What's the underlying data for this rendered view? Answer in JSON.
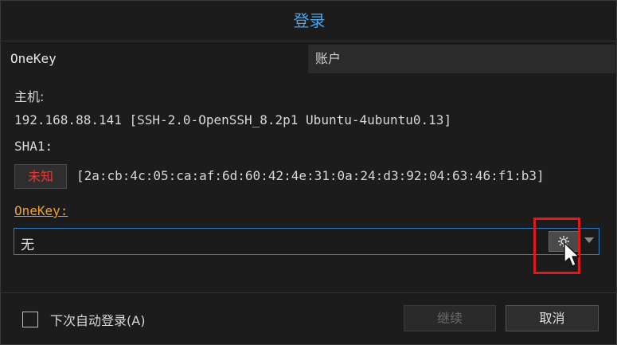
{
  "dialog": {
    "title": "登录",
    "tabs": [
      {
        "label": "OneKey",
        "active": true
      },
      {
        "label": "账户",
        "active": false
      }
    ]
  },
  "host": {
    "label": "主机:",
    "value": "192.168.88.141 [SSH-2.0-OpenSSH_8.2p1 Ubuntu-4ubuntu0.13]"
  },
  "sha1": {
    "label": "SHA1:",
    "status_button": "未知",
    "fingerprint": "[2a:cb:4c:05:ca:af:6d:60:42:4e:31:0a:24:d3:92:04:63:46:f1:b3]"
  },
  "onekey": {
    "label": "OneKey:",
    "selected_value": "无",
    "gear_icon": "gear-icon"
  },
  "footer": {
    "auto_login_label": "下次自动登录(A)",
    "auto_login_checked": false,
    "continue_label": "继续",
    "cancel_label": "取消"
  },
  "colors": {
    "title": "#4aa3e8",
    "unknown_status": "#e53935",
    "onekey_label": "#f0a030",
    "focus_border": "#2f7fc4",
    "highlight": "#e01a1a"
  }
}
